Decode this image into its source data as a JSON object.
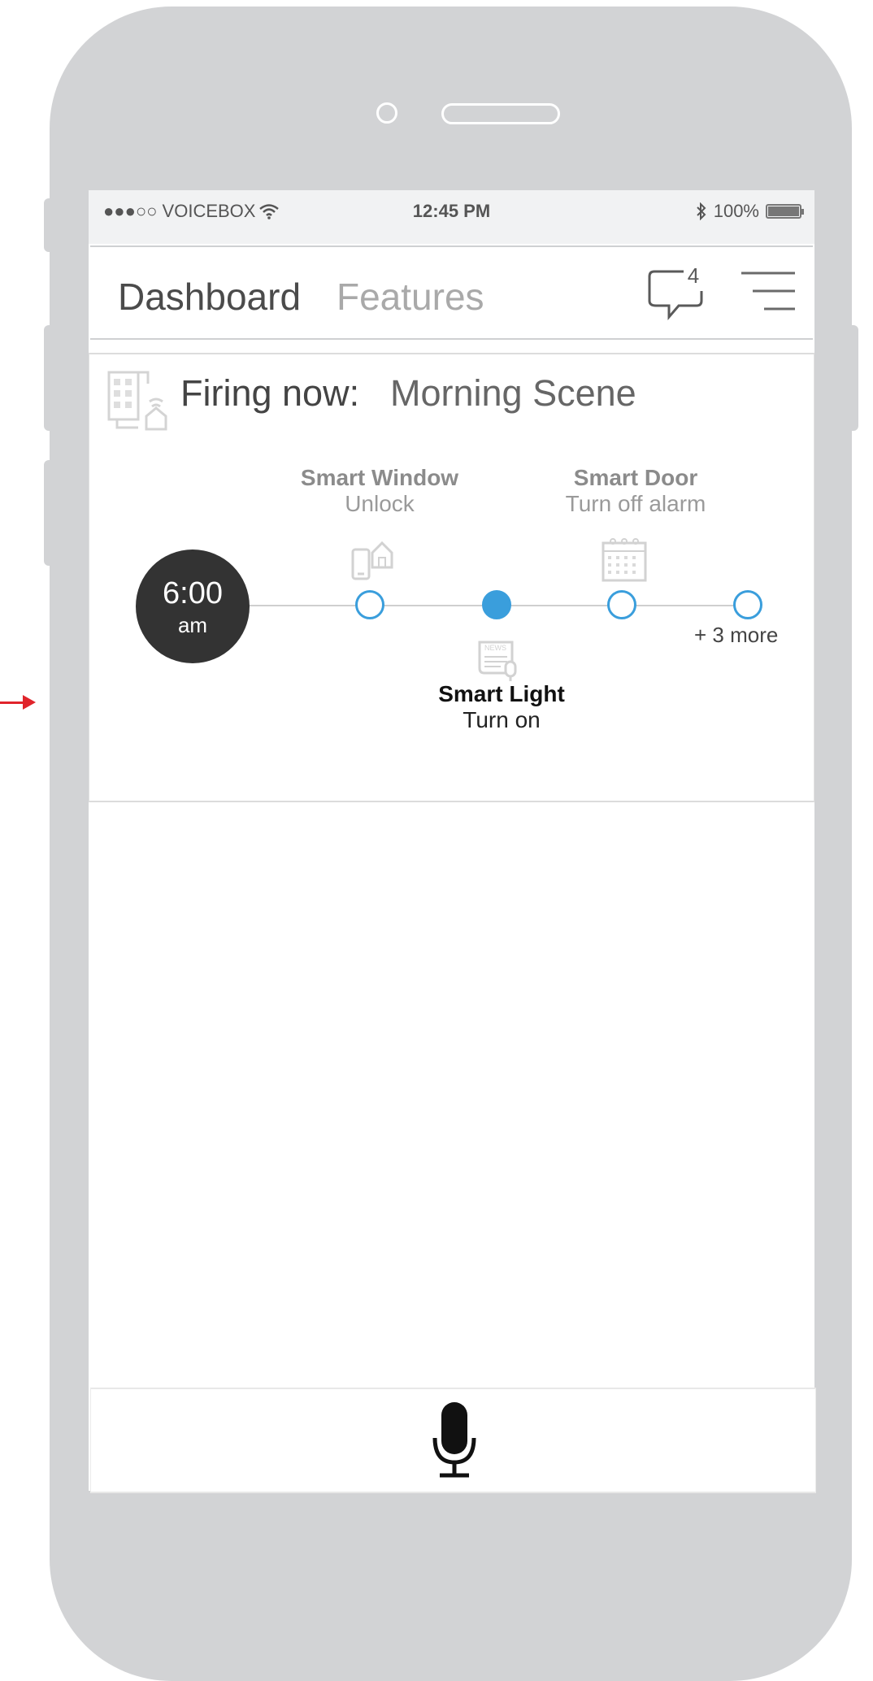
{
  "statusbar": {
    "carrier": "●●●○○ VOICEBOX",
    "time": "12:45 PM",
    "battery": "100%",
    "battery_level": 1.0
  },
  "navbar": {
    "title": "Dashboard",
    "tab": "Features",
    "notification_count": "4"
  },
  "scene": {
    "firing_label": "Firing now:",
    "scene_name": "Morning Scene",
    "time": "6:00",
    "time_period": "am",
    "steps": [
      {
        "name": "Smart Window",
        "action": "Unlock",
        "icon": "phone-house-icon"
      },
      {
        "name": "Smart Light",
        "action": "Turn on",
        "icon": "news-icon",
        "active": true
      },
      {
        "name": "Smart Door",
        "action": "Turn off alarm",
        "icon": "calendar-icon"
      }
    ],
    "more": "+ 3 more"
  },
  "colors": {
    "accent": "#3a9edc",
    "frame": "#d2d3d5",
    "time_circle": "#333333",
    "arrow": "#e0242b"
  },
  "icons": {
    "wifi": "wifi-icon",
    "bluetooth": "bluetooth-icon",
    "chat": "chat-bubble-icon",
    "menu": "hamburger-menu-icon",
    "building": "building-icon",
    "mic": "microphone-icon"
  }
}
